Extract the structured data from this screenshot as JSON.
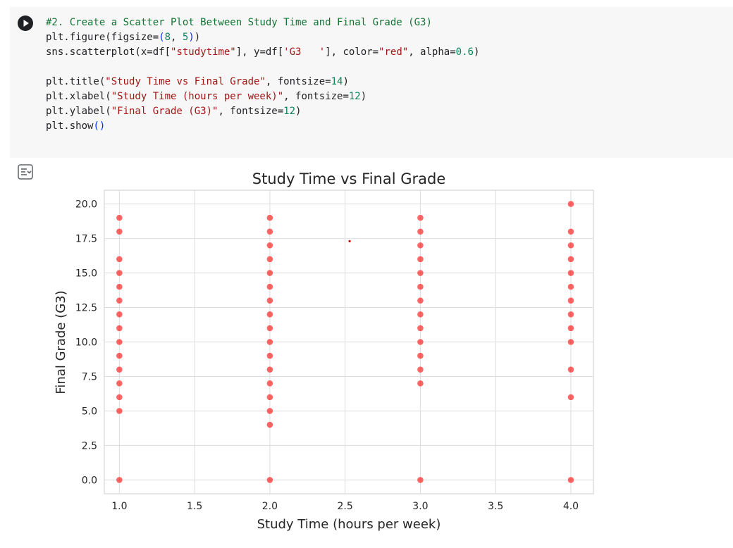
{
  "notebook": {
    "code_lines": [
      [
        {
          "t": "#2. Create a Scatter Plot Between Study Time and Final Grade (G3)",
          "c": "comment"
        }
      ],
      [
        {
          "t": "plt.figure(figsize="
        },
        {
          "t": "(",
          "c": "paren"
        },
        {
          "t": "8",
          "c": "num"
        },
        {
          "t": ", "
        },
        {
          "t": "5",
          "c": "num"
        },
        {
          "t": ")",
          "c": "paren"
        },
        {
          "t": ")"
        }
      ],
      [
        {
          "t": "sns.scatterplot(x=df["
        },
        {
          "t": "\"studytime\"",
          "c": "str"
        },
        {
          "t": "], y=df["
        },
        {
          "t": "'G3   '",
          "c": "str"
        },
        {
          "t": "], color="
        },
        {
          "t": "\"red\"",
          "c": "str"
        },
        {
          "t": ", alpha="
        },
        {
          "t": "0.6",
          "c": "num"
        },
        {
          "t": ")"
        }
      ],
      [],
      [
        {
          "t": "plt.title("
        },
        {
          "t": "\"Study Time vs Final Grade\"",
          "c": "str"
        },
        {
          "t": ", fontsize="
        },
        {
          "t": "14",
          "c": "num"
        },
        {
          "t": ")"
        }
      ],
      [
        {
          "t": "plt.xlabel("
        },
        {
          "t": "\"Study Time (hours per week)\"",
          "c": "str"
        },
        {
          "t": ", fontsize="
        },
        {
          "t": "12",
          "c": "num"
        },
        {
          "t": ")"
        }
      ],
      [
        {
          "t": "plt.ylabel("
        },
        {
          "t": "\"Final Grade (G3)\"",
          "c": "str"
        },
        {
          "t": ", fontsize="
        },
        {
          "t": "12",
          "c": "num"
        },
        {
          "t": ")"
        }
      ],
      [
        {
          "t": "plt.show"
        },
        {
          "t": "()",
          "c": "paren"
        }
      ]
    ],
    "run_icon": "play-icon",
    "output_icon": "output-toggle-icon"
  },
  "chart_data": {
    "type": "scatter",
    "title": "Study Time vs Final Grade",
    "xlabel": "Study Time (hours per week)",
    "ylabel": "Final Grade (G3)",
    "xlim": [
      0.9,
      4.15
    ],
    "ylim": [
      -1.0,
      21.0
    ],
    "xticks": [
      "1.0",
      "1.5",
      "2.0",
      "2.5",
      "3.0",
      "3.5",
      "4.0"
    ],
    "yticks": [
      "0.0",
      "2.5",
      "5.0",
      "7.5",
      "10.0",
      "12.5",
      "15.0",
      "17.5",
      "20.0"
    ],
    "grid": true,
    "color": "#ff0000",
    "alpha": 0.6,
    "points": [
      {
        "x": 1,
        "y": 0
      },
      {
        "x": 1,
        "y": 5
      },
      {
        "x": 1,
        "y": 6
      },
      {
        "x": 1,
        "y": 7
      },
      {
        "x": 1,
        "y": 8
      },
      {
        "x": 1,
        "y": 9
      },
      {
        "x": 1,
        "y": 10
      },
      {
        "x": 1,
        "y": 11
      },
      {
        "x": 1,
        "y": 12
      },
      {
        "x": 1,
        "y": 13
      },
      {
        "x": 1,
        "y": 14
      },
      {
        "x": 1,
        "y": 15
      },
      {
        "x": 1,
        "y": 16
      },
      {
        "x": 1,
        "y": 18
      },
      {
        "x": 1,
        "y": 19
      },
      {
        "x": 2,
        "y": 0
      },
      {
        "x": 2,
        "y": 4
      },
      {
        "x": 2,
        "y": 5
      },
      {
        "x": 2,
        "y": 6
      },
      {
        "x": 2,
        "y": 7
      },
      {
        "x": 2,
        "y": 8
      },
      {
        "x": 2,
        "y": 9
      },
      {
        "x": 2,
        "y": 10
      },
      {
        "x": 2,
        "y": 11
      },
      {
        "x": 2,
        "y": 12
      },
      {
        "x": 2,
        "y": 13
      },
      {
        "x": 2,
        "y": 14
      },
      {
        "x": 2,
        "y": 15
      },
      {
        "x": 2,
        "y": 16
      },
      {
        "x": 2,
        "y": 17
      },
      {
        "x": 2,
        "y": 18
      },
      {
        "x": 2,
        "y": 19
      },
      {
        "x": 3,
        "y": 0
      },
      {
        "x": 3,
        "y": 7
      },
      {
        "x": 3,
        "y": 8
      },
      {
        "x": 3,
        "y": 9
      },
      {
        "x": 3,
        "y": 10
      },
      {
        "x": 3,
        "y": 11
      },
      {
        "x": 3,
        "y": 12
      },
      {
        "x": 3,
        "y": 13
      },
      {
        "x": 3,
        "y": 14
      },
      {
        "x": 3,
        "y": 15
      },
      {
        "x": 3,
        "y": 16
      },
      {
        "x": 3,
        "y": 17
      },
      {
        "x": 3,
        "y": 18
      },
      {
        "x": 3,
        "y": 19
      },
      {
        "x": 4,
        "y": 0
      },
      {
        "x": 4,
        "y": 6
      },
      {
        "x": 4,
        "y": 8
      },
      {
        "x": 4,
        "y": 10
      },
      {
        "x": 4,
        "y": 11
      },
      {
        "x": 4,
        "y": 12
      },
      {
        "x": 4,
        "y": 13
      },
      {
        "x": 4,
        "y": 14
      },
      {
        "x": 4,
        "y": 15
      },
      {
        "x": 4,
        "y": 16
      },
      {
        "x": 4,
        "y": 17
      },
      {
        "x": 4,
        "y": 18
      },
      {
        "x": 4,
        "y": 20
      }
    ],
    "stray_marker": {
      "x": 2.53,
      "y": 17.3
    }
  }
}
